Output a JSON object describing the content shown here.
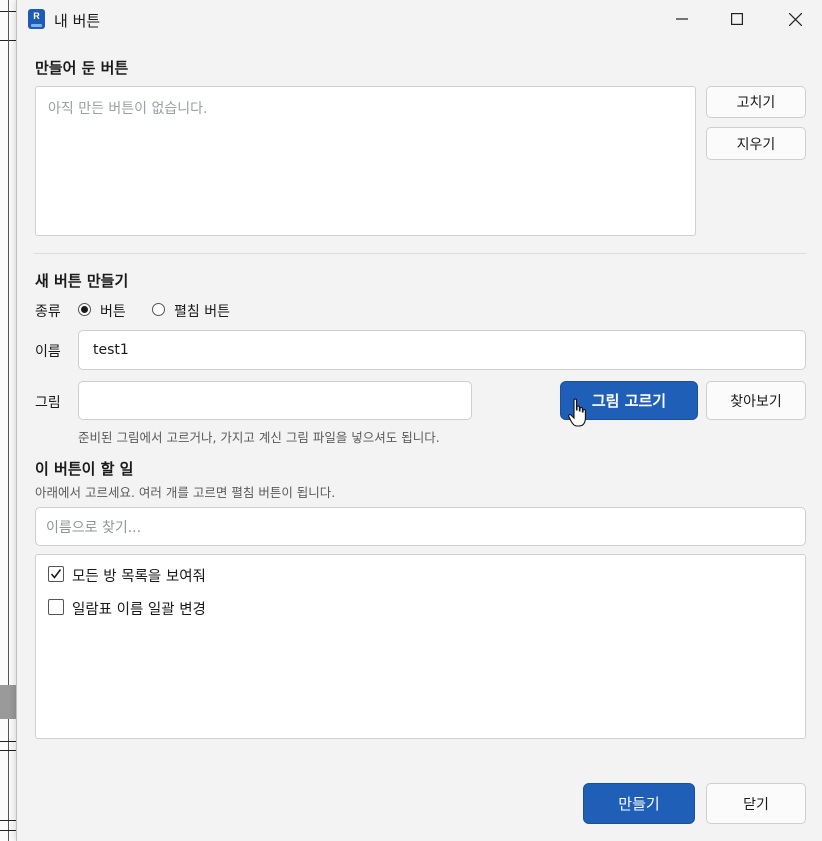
{
  "window": {
    "title": "내 버튼"
  },
  "existing": {
    "heading": "만들어 둔 버튼",
    "empty_text": "아직 만든 버튼이 없습니다.",
    "edit_label": "고치기",
    "delete_label": "지우기"
  },
  "create": {
    "heading": "새 버튼 만들기",
    "type_label": "종류",
    "type_options": [
      {
        "label": "버튼",
        "checked": true
      },
      {
        "label": "펼침 버튼",
        "checked": false
      }
    ],
    "name_label": "이름",
    "name_value": "test1",
    "image_label": "그림",
    "image_value": "",
    "pick_image_label": "그림 고르기",
    "browse_label": "찾아보기",
    "image_hint": "준비된 그림에서 고르거나, 가지고 계신 그림 파일을 넣으셔도 됩니다."
  },
  "actions": {
    "heading": "이 버튼이 할 일",
    "hint": "아래에서 고르세요. 여러 개를 고르면 펼침 버튼이 됩니다.",
    "search_placeholder": "이름으로 찾기...",
    "items": [
      {
        "label": "모든 방 목록을 보여줘",
        "checked": true
      },
      {
        "label": "일람표 이름 일괄 변경",
        "checked": false
      }
    ]
  },
  "footer": {
    "create_label": "만들기",
    "close_label": "닫기"
  },
  "colors": {
    "primary": "#1f5fb8",
    "window_bg": "#f3f3f3"
  },
  "icons": {
    "app": "revit-app-icon",
    "minimize": "minimize-icon",
    "maximize": "maximize-icon",
    "close": "close-icon",
    "cursor": "hand-pointer-icon"
  }
}
